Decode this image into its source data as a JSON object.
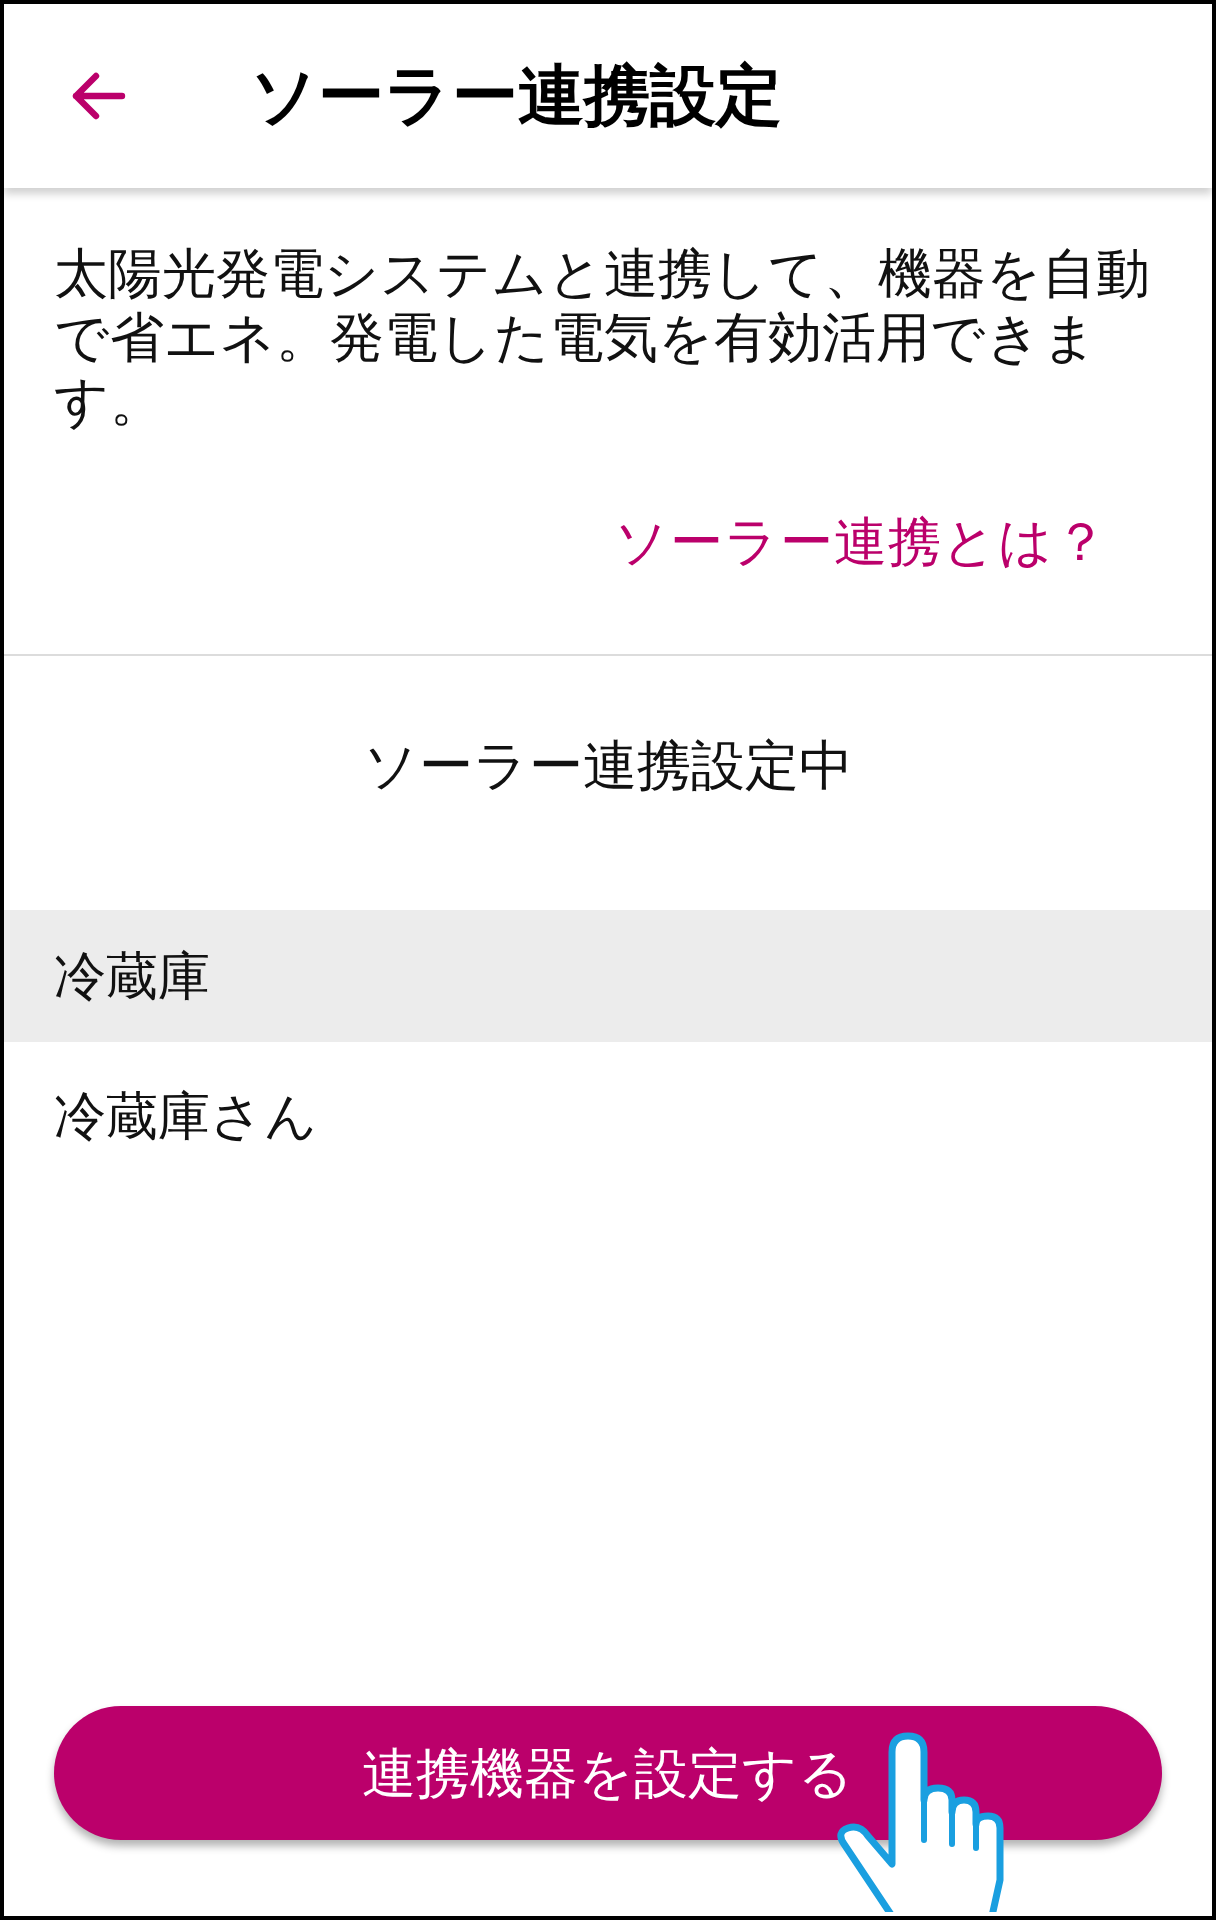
{
  "header": {
    "title": "ソーラー連携設定"
  },
  "description": "太陽光発電システムと連携して、機器を自動で省エネ。発電した電気を有効活用できます。",
  "help_link": "ソーラー連携とは？",
  "status": "ソーラー連携設定中",
  "device_groups": [
    {
      "category": "冷蔵庫",
      "devices": [
        {
          "name": "冷蔵庫さん"
        }
      ]
    }
  ],
  "action_button": {
    "label": "連携機器を設定する"
  }
}
